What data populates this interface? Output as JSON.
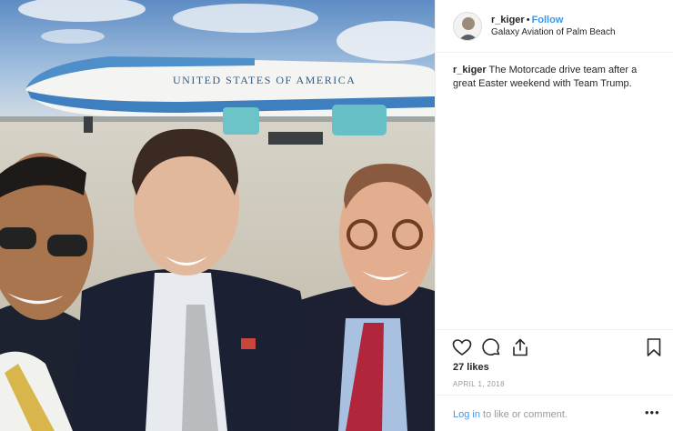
{
  "post": {
    "username": "r_kiger",
    "separator": "•",
    "follow_label": "Follow",
    "location": "Galaxy Aviation of Palm Beach",
    "caption_user": "r_kiger",
    "caption_text": " The Motorcade drive team after a great Easter weekend with Team Trump.",
    "likes": "27 likes",
    "date": "APRIL 1, 2018",
    "comment_login": "Log in",
    "comment_rest": " to like or comment.",
    "more_label": "•••",
    "photo_plane_text": "UNITED STATES OF AMERICA"
  },
  "colors": {
    "accent": "#3897f0",
    "text": "#262626",
    "muted": "#999999",
    "divider": "#efefef"
  },
  "icons": [
    "heart-icon",
    "comment-icon",
    "share-icon",
    "bookmark-icon",
    "more-options-icon"
  ]
}
